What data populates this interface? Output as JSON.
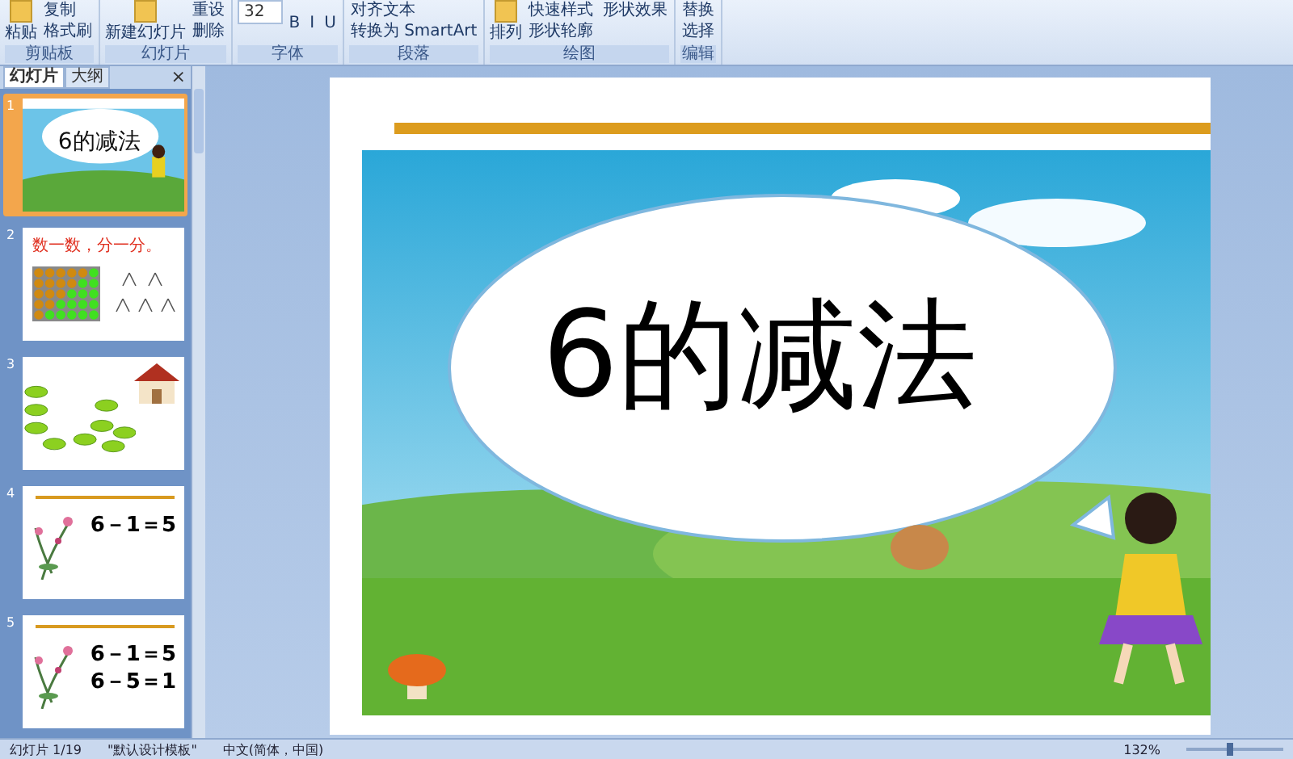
{
  "ribbon": {
    "groups": [
      {
        "label": "剪贴板",
        "big": "粘贴",
        "commands": [
          "复制",
          "格式刷"
        ]
      },
      {
        "label": "幻灯片",
        "big": "新建幻灯片",
        "commands": [
          "重设",
          "删除"
        ]
      },
      {
        "label": "字体",
        "font_size": "32",
        "commands": [
          "B",
          "I",
          "U"
        ]
      },
      {
        "label": "段落",
        "commands": [
          "对齐文本",
          "转换为 SmartArt"
        ]
      },
      {
        "label": "绘图",
        "big": "排列",
        "commands": [
          "快速样式",
          "形状轮廓",
          "形状效果"
        ]
      },
      {
        "label": "编辑",
        "commands": [
          "替换",
          "选择"
        ]
      }
    ]
  },
  "panel": {
    "tabs": [
      {
        "label": "幻灯片",
        "selected": true
      },
      {
        "label": "大纲",
        "selected": false
      }
    ],
    "close": "×"
  },
  "thumbnails": [
    {
      "number": "1",
      "selected": true,
      "kind": "title",
      "texts": [
        "6的减法"
      ]
    },
    {
      "number": "2",
      "selected": false,
      "kind": "counting",
      "texts": [
        "数一数，分一分。"
      ]
    },
    {
      "number": "3",
      "selected": false,
      "kind": "ovals"
    },
    {
      "number": "4",
      "selected": false,
      "kind": "equation",
      "texts": [
        "6－1＝5"
      ]
    },
    {
      "number": "5",
      "selected": false,
      "kind": "equation",
      "texts": [
        "6－1＝5",
        "6－5＝1"
      ]
    }
  ],
  "slide": {
    "title": "6的减法"
  },
  "status_bar": {
    "slide": "幻灯片 1/19",
    "theme": "\"默认设计模板\"",
    "language": "中文(简体，中国)",
    "zoom": "132%",
    "zoom_slider": {
      "level": 0.45
    }
  }
}
